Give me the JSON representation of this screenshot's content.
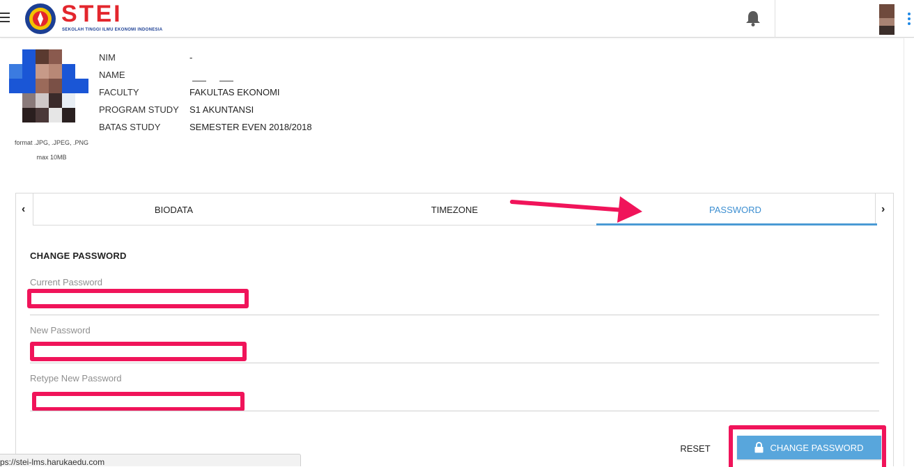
{
  "header": {
    "logo_title": "STEI",
    "logo_subtitle": "SEKOLAH TINGGI ILMU EKONOMI INDONESIA",
    "icons": [
      "menu-icon",
      "bell-icon",
      "more-vert-icon"
    ],
    "accent_color": "#e3262d"
  },
  "profile": {
    "hint_format": "format .JPG, .JPEG, .PNG",
    "hint_size": "max 10MB",
    "fields": [
      {
        "label": "NIM",
        "value": "-"
      },
      {
        "label": "NAME",
        "value": ""
      },
      {
        "label": "FACULTY",
        "value": "FAKULTAS EKONOMI"
      },
      {
        "label": "PROGRAM STUDY",
        "value": "S1 AKUNTANSI"
      },
      {
        "label": "BATAS STUDY",
        "value": "SEMESTER EVEN 2018/2018"
      }
    ]
  },
  "tabs": {
    "items": [
      {
        "label": "BIODATA",
        "active": false
      },
      {
        "label": "TIMEZONE",
        "active": false
      },
      {
        "label": "PASSWORD",
        "active": true
      }
    ],
    "prev_arrow": "‹",
    "next_arrow": "›",
    "active_color": "#3d8fd1"
  },
  "password_form": {
    "title": "CHANGE PASSWORD",
    "current_label": "Current Password",
    "new_label": "New Password",
    "retype_label": "Retype New Password",
    "reset_label": "RESET",
    "submit_label": "CHANGE PASSWORD",
    "submit_icon": "lock-icon",
    "highlight_color": "#f0145a",
    "button_color": "#58a6dc"
  },
  "status_bar": {
    "url": "ps://stei-lms.harukaedu.com"
  }
}
